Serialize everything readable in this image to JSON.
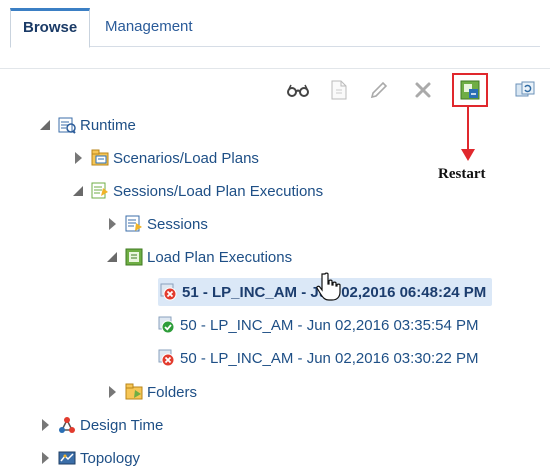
{
  "tabs": [
    {
      "label": "Browse",
      "active": true
    },
    {
      "label": "Management",
      "active": false
    }
  ],
  "toolbar": {
    "icons": [
      "glasses-icon",
      "new-doc-icon",
      "edit-icon",
      "delete-icon",
      "restart-icon",
      "refresh-icon"
    ],
    "highlighted": "restart-icon"
  },
  "callout": {
    "label": "Restart",
    "color": "#e0282d"
  },
  "tree": {
    "runtime": "Runtime",
    "scenarios": "Scenarios/Load Plans",
    "sessions_lpe": "Sessions/Load Plan Executions",
    "sessions": "Sessions",
    "load_plan_executions": "Load Plan Executions",
    "executions": [
      {
        "label": "51 - LP_INC_AM - Jun 02,2016 06:48:24 PM",
        "status": "error",
        "selected": true
      },
      {
        "label": "50 - LP_INC_AM - Jun 02,2016 03:35:54 PM",
        "status": "success",
        "selected": false
      },
      {
        "label": "50 - LP_INC_AM - Jun 02,2016 03:30:22 PM",
        "status": "error",
        "selected": false
      }
    ],
    "folders": "Folders",
    "design_time": "Design Time",
    "topology": "Topology"
  }
}
